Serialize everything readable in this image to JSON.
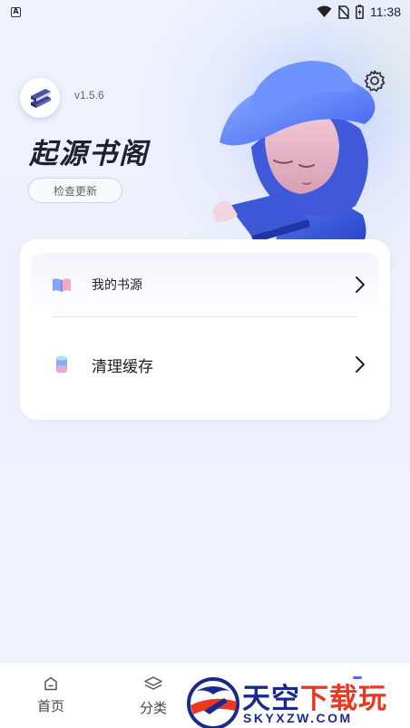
{
  "status_bar": {
    "time": "11:38",
    "icons": [
      "accessibility-a-icon",
      "wifi-icon",
      "no-sim-icon",
      "battery-charging-icon"
    ]
  },
  "header": {
    "version": "v1.5.6",
    "app_name": "起源书阁",
    "update_button": "检查更新",
    "settings_icon": "gear-icon"
  },
  "menu": {
    "items": [
      {
        "label": "我的书源",
        "icon": "book-source-icon"
      },
      {
        "label": "清理缓存",
        "icon": "clear-cache-icon"
      }
    ]
  },
  "bottom_nav": {
    "items": [
      {
        "label": "首页",
        "icon": "home-icon"
      },
      {
        "label": "分类",
        "icon": "layers-icon"
      },
      {
        "label": "",
        "icon": "mine-icon"
      }
    ]
  },
  "watermark": {
    "main_a": "天空",
    "main_b": "下载玩",
    "sub": "SKYXZW.COM"
  },
  "colors": {
    "accent_blue": "#4a6cf0",
    "background": "#eef1fb",
    "card": "#ffffff",
    "watermark_blue": "#1a2a8c",
    "watermark_red": "#e8381f"
  }
}
